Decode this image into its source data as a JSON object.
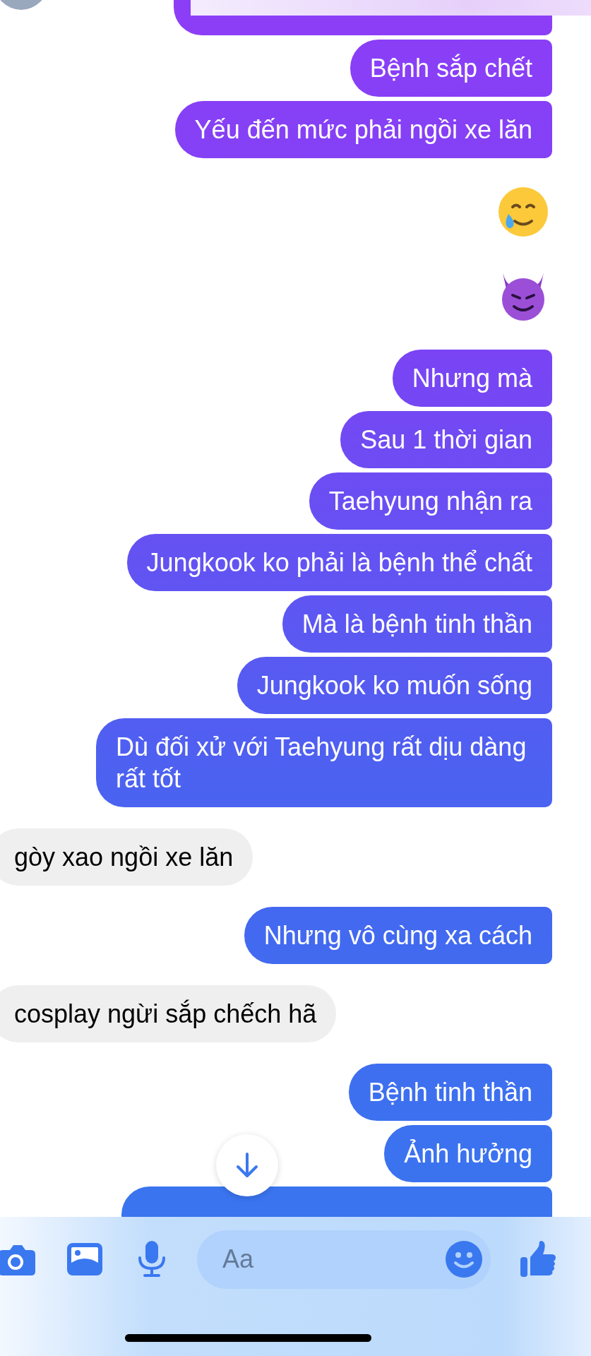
{
  "messages": [
    {
      "kind": "outgoing",
      "text": "Bệnh sắp chết"
    },
    {
      "kind": "outgoing",
      "text": "Yếu đến mức phải ngồi xe lăn"
    },
    {
      "kind": "teary"
    },
    {
      "kind": "devil"
    },
    {
      "kind": "outgoing",
      "text": "Nhưng mà"
    },
    {
      "kind": "outgoing",
      "text": "Sau 1 thời gian"
    },
    {
      "kind": "outgoing",
      "text": "Taehyung nhận ra"
    },
    {
      "kind": "outgoing",
      "text": "Jungkook ko phải là bệnh thể chất"
    },
    {
      "kind": "outgoing",
      "text": "Mà là bệnh tinh thần"
    },
    {
      "kind": "outgoing",
      "text": "Jungkook ko muốn sống"
    },
    {
      "kind": "outgoing",
      "text": "Dù đối xử với Taehyung rất dịu dàng rất tốt"
    },
    {
      "kind": "incoming",
      "text": "gòy xao ngồi xe lăn"
    },
    {
      "kind": "outgoing",
      "text": "Nhưng vô cùng xa cách"
    },
    {
      "kind": "incoming",
      "text": "cosplay ngừi sắp chếch hã"
    },
    {
      "kind": "outgoing",
      "text": "Bệnh tinh thần"
    },
    {
      "kind": "outgoing",
      "text": "Ảnh hưởng"
    }
  ],
  "composer": {
    "placeholder": "Aa"
  }
}
